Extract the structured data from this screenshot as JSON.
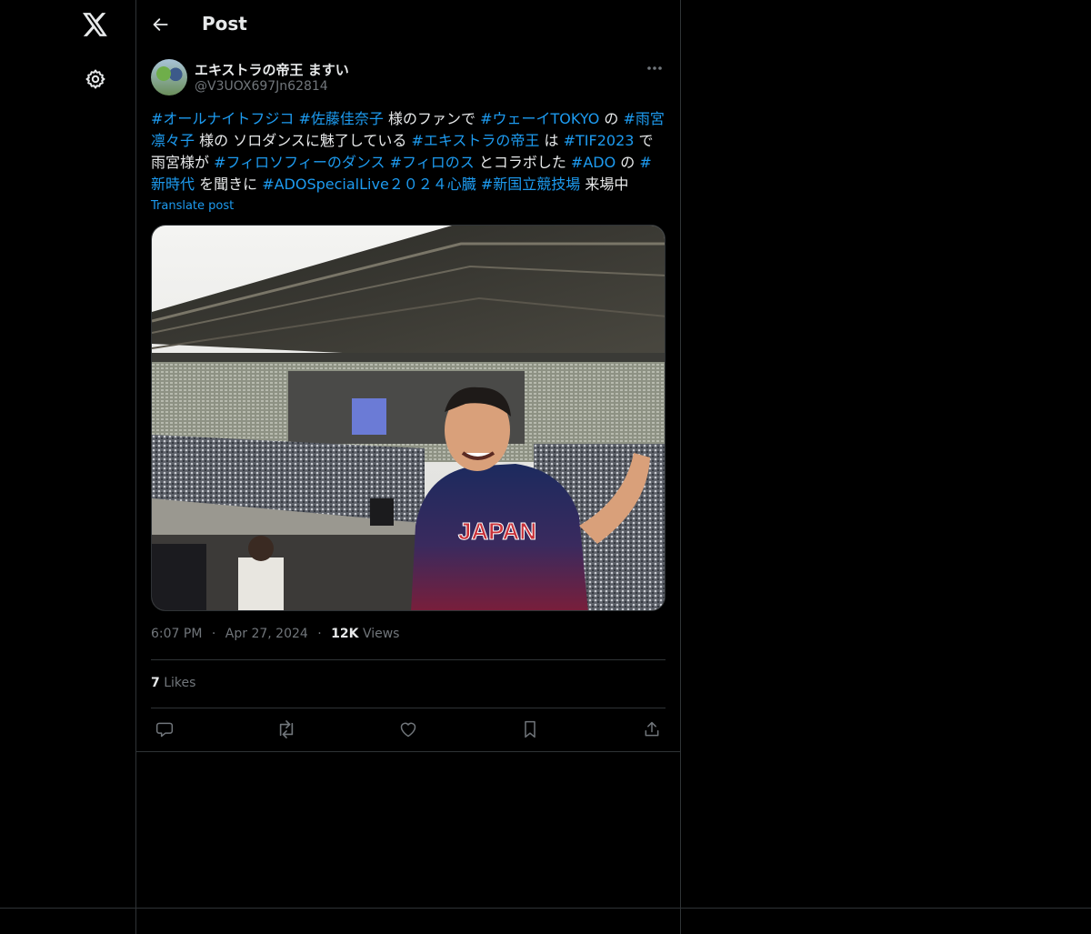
{
  "header": {
    "title": "Post"
  },
  "author": {
    "display_name": "エキストラの帝王 ますい",
    "handle": "@V3UOX697Jn62814"
  },
  "post": {
    "segments": [
      {
        "text": "#オールナイトフジコ",
        "tag": true
      },
      {
        "text": " ",
        "tag": false
      },
      {
        "text": "#佐藤佳奈子",
        "tag": true
      },
      {
        "text": " 様のファンで ",
        "tag": false
      },
      {
        "text": "#ウェーイTOKYO",
        "tag": true
      },
      {
        "text": " の ",
        "tag": false
      },
      {
        "text": "#雨宮凛々子",
        "tag": true
      },
      {
        "text": " 様の ソロダンスに魅了している ",
        "tag": false
      },
      {
        "text": "#エキストラの帝王",
        "tag": true
      },
      {
        "text": " は ",
        "tag": false
      },
      {
        "text": "#TIF2023",
        "tag": true
      },
      {
        "text": " で雨宮様が ",
        "tag": false
      },
      {
        "text": "#フィロソフィーのダンス",
        "tag": true
      },
      {
        "text": " ",
        "tag": false
      },
      {
        "text": "#フィロのス",
        "tag": true
      },
      {
        "text": " とコラボした ",
        "tag": false
      },
      {
        "text": "#ADO",
        "tag": true
      },
      {
        "text": " の ",
        "tag": false
      },
      {
        "text": "#新時代",
        "tag": true
      },
      {
        "text": " を聞きに ",
        "tag": false
      },
      {
        "text": "#ADOSpecialLive２０２４心臓",
        "tag": true
      },
      {
        "text": " ",
        "tag": false
      },
      {
        "text": "#新国立競技場",
        "tag": true
      },
      {
        "text": " 来場中",
        "tag": false
      }
    ],
    "translate_label": "Translate post",
    "jersey_text": "JAPAN"
  },
  "meta": {
    "time": "6:07 PM",
    "sep": "·",
    "date": "Apr 27, 2024",
    "views_count": "12K",
    "views_label": "Views"
  },
  "engagement": {
    "likes_count": "7",
    "likes_label": "Likes"
  },
  "colors": {
    "accent": "#1d9bf0",
    "text": "#e7e9ea",
    "muted": "#71767b",
    "border": "#2f3336",
    "background": "#000000"
  },
  "icons": {
    "logo": "x-logo-icon",
    "settings": "gear-icon",
    "back": "arrow-left-icon",
    "more": "more-dots-icon",
    "reply": "reply-icon",
    "repost": "repost-icon",
    "like": "heart-icon",
    "bookmark": "bookmark-icon",
    "share": "share-icon"
  }
}
